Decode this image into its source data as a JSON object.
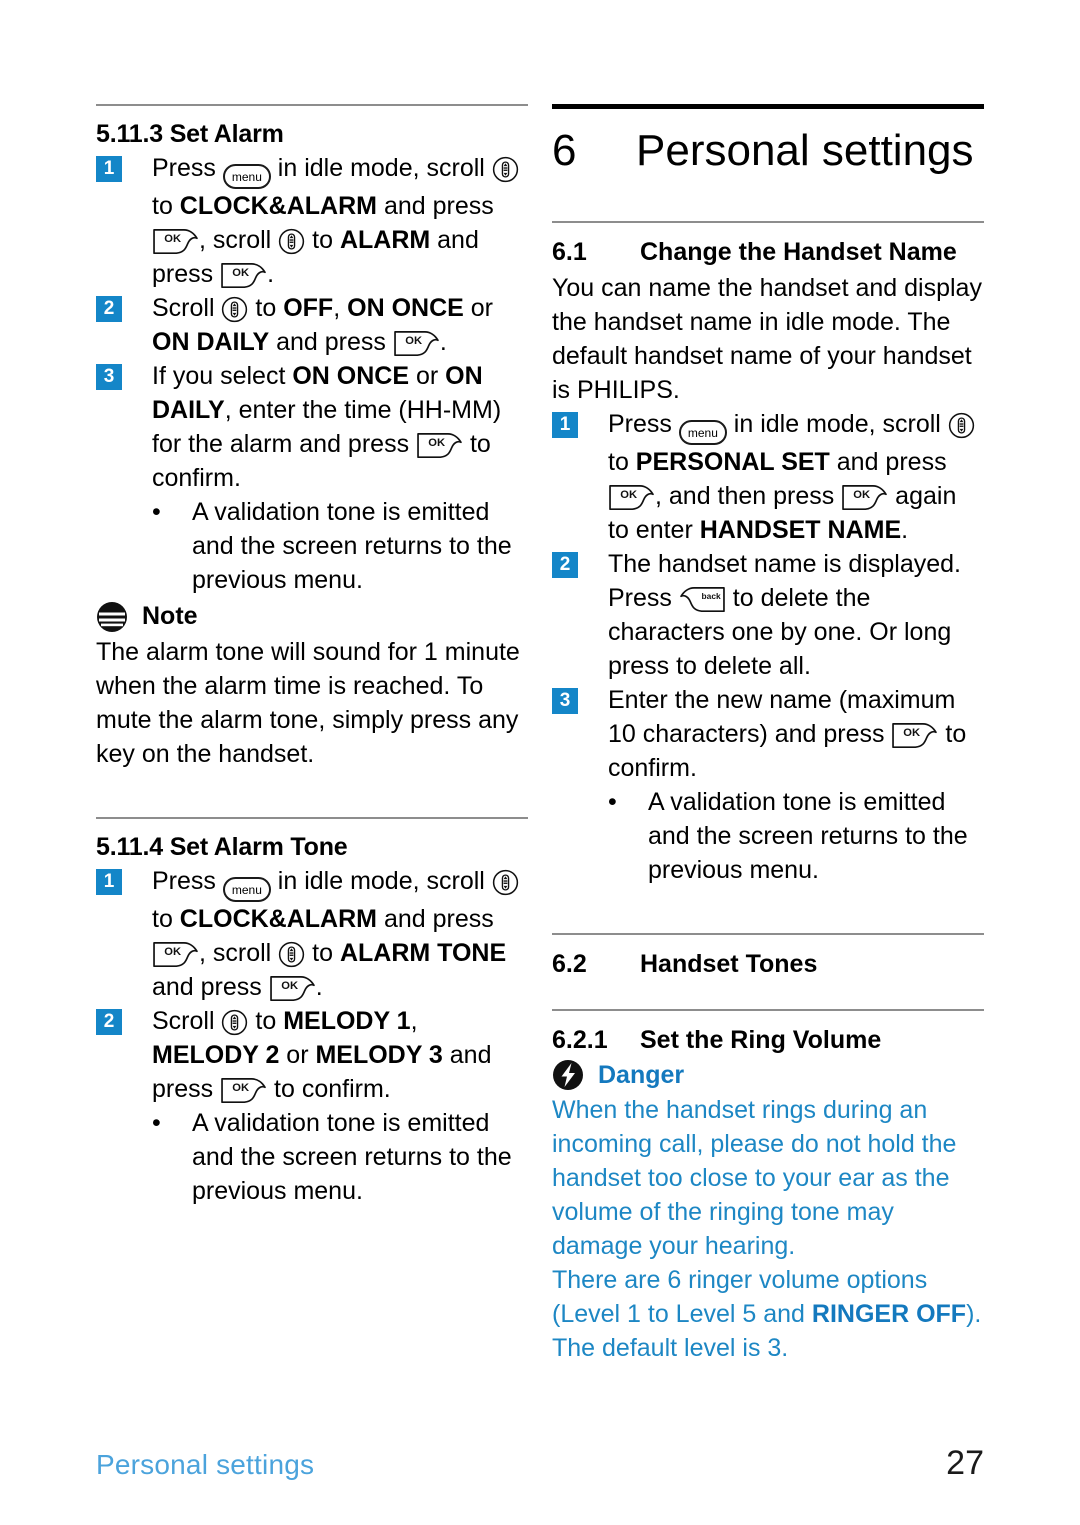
{
  "page": {
    "number": "27",
    "footer_label": "Personal settings"
  },
  "colors": {
    "badge_blue": "#1486C8",
    "danger_blue": "#1479BE",
    "danger_body_blue": "#1D87C4",
    "footer_blue": "#4BA3DC",
    "rule_gray": "#8D8D8D"
  },
  "icons": {
    "menu": "menu",
    "ok": "OK",
    "back": "back",
    "scroll": "scroll-key",
    "note": "note-icon",
    "danger": "danger-icon"
  },
  "left_column": {
    "section_5_11_3": {
      "number": "5.11.3",
      "title": "Set Alarm",
      "steps": [
        {
          "num": "1",
          "p1": "Press ",
          "p2": " in idle mode, scroll ",
          "p3": " to ",
          "b1": "CLOCK&ALARM",
          "p4": " and press ",
          "p5": ", scroll ",
          "p6": " to ",
          "b2": "ALARM",
          "p7": " and press ",
          "p8": "."
        },
        {
          "num": "2",
          "p1": "Scroll ",
          "p2": " to ",
          "b1": "OFF",
          "p3": ", ",
          "b2": "ON ONCE",
          "p4": " or ",
          "b3": "ON DAILY",
          "p5": " and press ",
          "p6": "."
        },
        {
          "num": "3",
          "p1": "If you select ",
          "b1": "ON ONCE",
          "p2": " or ",
          "b2": "ON DAILY",
          "p3": ", enter the time (HH-MM) for the alarm and press ",
          "p4": " to confirm."
        }
      ],
      "bullet": "A validation tone is emitted and the screen returns to the previous menu."
    },
    "note": {
      "label": "Note",
      "text": "The alarm tone will sound for 1 minute when the alarm time is reached. To mute the alarm tone, simply press any key on the handset."
    },
    "section_5_11_4": {
      "number": "5.11.4",
      "title": "Set Alarm Tone",
      "steps": [
        {
          "num": "1",
          "p1": "Press ",
          "p2": " in idle mode, scroll ",
          "p3": " to ",
          "b1": "CLOCK&ALARM",
          "p4": " and press ",
          "p5": ", scroll ",
          "p6": " to ",
          "b2": "ALARM TONE",
          "p7": " and press ",
          "p8": "."
        },
        {
          "num": "2",
          "p1": "Scroll ",
          "p2": " to ",
          "b1": "MELODY 1",
          "p3": ", ",
          "b2": "MELODY 2",
          "p4": " or ",
          "b3": "MELODY 3",
          "p5": " and press ",
          "p6": " to confirm."
        }
      ],
      "bullet": "A validation tone is emitted and the screen returns to the previous menu."
    }
  },
  "right_column": {
    "chapter": {
      "number": "6",
      "title": "Personal settings"
    },
    "section_6_1": {
      "number": "6.1",
      "title": "Change the Handset Name",
      "intro": "You can name the handset and display the handset name in idle mode. The default handset name of your handset is PHILIPS.",
      "steps": [
        {
          "num": "1",
          "p1": "Press ",
          "p2": " in idle mode, scroll ",
          "p3": " to ",
          "b1": "PERSONAL SET",
          "p4": " and press ",
          "p5": ", and then press ",
          "p6": " again to enter ",
          "b2": "HANDSET NAME",
          "p7": "."
        },
        {
          "num": "2",
          "p1": "The handset name is displayed. Press ",
          "p2": " to delete the characters one by one. Or long press to delete all."
        },
        {
          "num": "3",
          "p1": "Enter the new name (maximum 10 characters) and press ",
          "p2": " to confirm."
        }
      ],
      "bullet": "A validation tone is emitted and the screen returns to the previous menu."
    },
    "section_6_2": {
      "number": "6.2",
      "title": "Handset Tones"
    },
    "section_6_2_1": {
      "number": "6.2.1",
      "title": "Set the Ring Volume",
      "danger": {
        "label": "Danger",
        "paragraph1": "When the handset rings during an incoming call, please do not hold the handset too close to your ear as the volume of the ringing tone may damage your hearing.",
        "p2_a": "There are 6 ringer volume options (Level 1 to Level 5 and ",
        "p2_b": "RINGER OFF",
        "p2_c": "). The default level is 3."
      }
    }
  }
}
